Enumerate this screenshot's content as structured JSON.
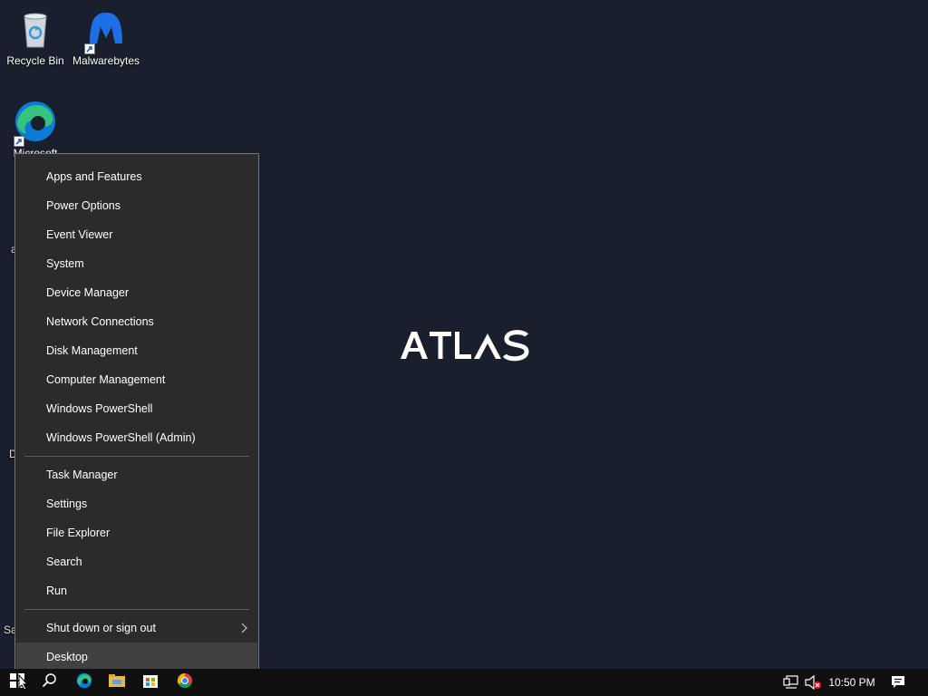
{
  "desktop": {
    "icons": [
      {
        "label": "Recycle Bin",
        "icon": "recycle-bin-icon"
      },
      {
        "label": "Malwarebytes",
        "icon": "malwarebytes-icon"
      },
      {
        "label": "Microsoft",
        "icon": "edge-icon"
      }
    ],
    "edge_fragments": [
      "a",
      "D",
      "Sa"
    ],
    "wallpaper_logo": "ATLAS"
  },
  "context_menu": {
    "group1": [
      "Apps and Features",
      "Power Options",
      "Event Viewer",
      "System",
      "Device Manager",
      "Network Connections",
      "Disk Management",
      "Computer Management",
      "Windows PowerShell",
      "Windows PowerShell (Admin)"
    ],
    "group2": [
      "Task Manager",
      "Settings",
      "File Explorer",
      "Search",
      "Run"
    ],
    "shutdown_label": "Shut down or sign out",
    "desktop_label": "Desktop"
  },
  "taskbar": {
    "pinned": [
      "start-icon",
      "search-icon",
      "edge-icon",
      "file-explorer-icon",
      "store-icon",
      "chrome-icon"
    ],
    "clock": "10:50 PM",
    "tray": [
      "network-icon",
      "volume-muted-icon",
      "notifications-icon"
    ]
  },
  "colors": {
    "wallpaper": "#1a1f2e",
    "menu_bg": "#2b2b2b",
    "menu_hover": "#414141",
    "taskbar": "#101010"
  }
}
